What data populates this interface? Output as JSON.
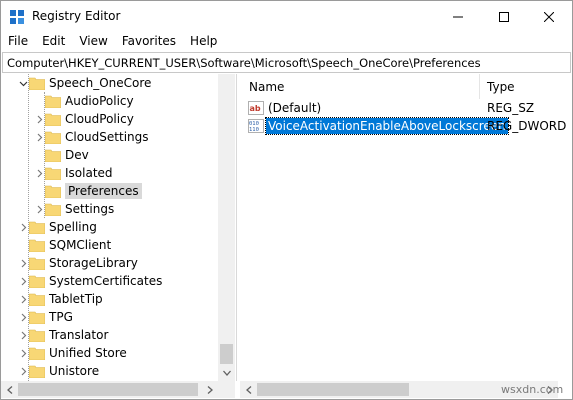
{
  "window": {
    "title": "Registry Editor",
    "icons": {
      "app": "registry-editor-icon",
      "min": "minimize-icon",
      "max": "maximize-icon",
      "close": "close-icon"
    }
  },
  "menu": {
    "items": [
      "File",
      "Edit",
      "View",
      "Favorites",
      "Help"
    ]
  },
  "address": {
    "path": "Computer\\HKEY_CURRENT_USER\\Software\\Microsoft\\Speech_OneCore\\Preferences"
  },
  "tree": {
    "items": [
      {
        "label": "Speech_OneCore",
        "level": 0,
        "state": "expanded"
      },
      {
        "label": "AudioPolicy",
        "level": 1,
        "state": "leaf"
      },
      {
        "label": "CloudPolicy",
        "level": 1,
        "state": "collapsed"
      },
      {
        "label": "CloudSettings",
        "level": 1,
        "state": "collapsed"
      },
      {
        "label": "Dev",
        "level": 1,
        "state": "leaf"
      },
      {
        "label": "Isolated",
        "level": 1,
        "state": "collapsed"
      },
      {
        "label": "Preferences",
        "level": 1,
        "state": "leaf",
        "selected": true
      },
      {
        "label": "Settings",
        "level": 1,
        "state": "collapsed"
      },
      {
        "label": "Spelling",
        "level": 0,
        "state": "collapsed"
      },
      {
        "label": "SQMClient",
        "level": 0,
        "state": "leaf"
      },
      {
        "label": "StorageLibrary",
        "level": 0,
        "state": "collapsed"
      },
      {
        "label": "SystemCertificates",
        "level": 0,
        "state": "collapsed"
      },
      {
        "label": "TabletTip",
        "level": 0,
        "state": "collapsed"
      },
      {
        "label": "TPG",
        "level": 0,
        "state": "collapsed"
      },
      {
        "label": "Translator",
        "level": 0,
        "state": "collapsed"
      },
      {
        "label": "Unified Store",
        "level": 0,
        "state": "collapsed"
      },
      {
        "label": "Unistore",
        "level": 0,
        "state": "collapsed"
      }
    ]
  },
  "list": {
    "columns": {
      "name": "Name",
      "type": "Type"
    },
    "rows": [
      {
        "name": "(Default)",
        "type": "REG_SZ",
        "icon": "string-value-icon",
        "selected": false
      },
      {
        "name": "VoiceActivationEnableAboveLockscreen",
        "type": "REG_DWORD",
        "icon": "binary-value-icon",
        "selected": true
      }
    ]
  },
  "watermark": "wsxdn.com",
  "colors": {
    "selection": "#0078d7",
    "folder": "#f8d775",
    "tree_selection": "#d9d9d9"
  }
}
